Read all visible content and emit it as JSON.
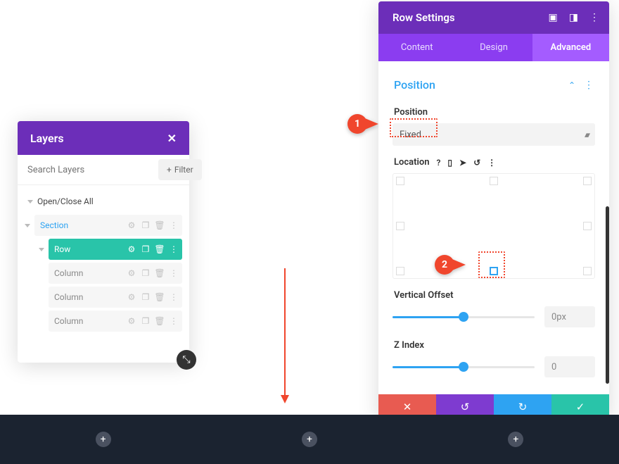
{
  "layers": {
    "title": "Layers",
    "search_placeholder": "Search Layers",
    "filter_label": "Filter",
    "open_close_all": "Open/Close All",
    "items": {
      "section": "Section",
      "row": "Row",
      "columns": [
        "Column",
        "Column",
        "Column"
      ]
    }
  },
  "settings": {
    "title": "Row Settings",
    "tabs": {
      "content": "Content",
      "design": "Design",
      "advanced": "Advanced"
    },
    "section": {
      "title": "Position"
    },
    "position": {
      "label": "Position",
      "value": "Fixed"
    },
    "location": {
      "label": "Location"
    },
    "vertical_offset": {
      "label": "Vertical Offset",
      "value": "0px"
    },
    "z_index": {
      "label": "Z Index",
      "value": "0"
    }
  },
  "callouts": {
    "one": "1",
    "two": "2"
  },
  "colors": {
    "purple": "#6c2eb9",
    "purple_light": "#8b3df0",
    "teal": "#29c4a9",
    "blue": "#2ea3f2",
    "red": "#e85b51",
    "callout": "#f0462d"
  }
}
